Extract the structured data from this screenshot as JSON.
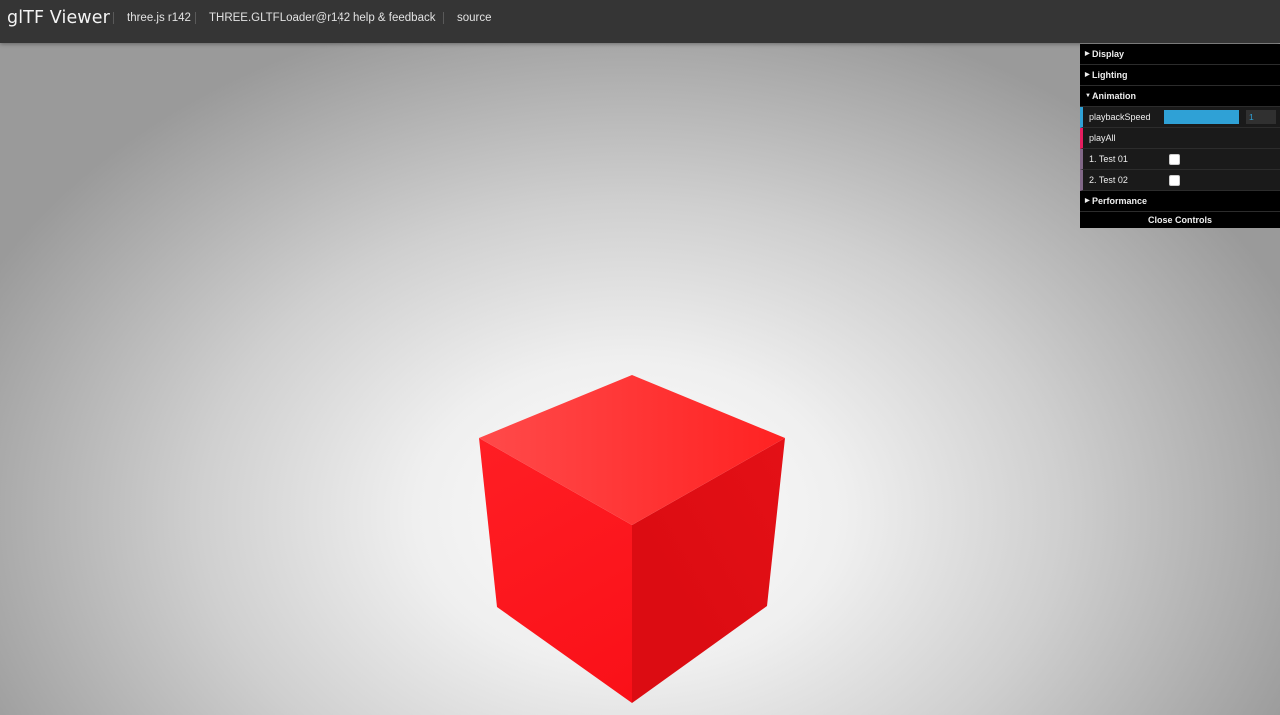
{
  "header": {
    "title": "glTF Viewer",
    "links": [
      "three.js r142",
      "THREE.GLTFLoader@r142",
      "help & feedback",
      "source"
    ]
  },
  "gui": {
    "folders": {
      "display": "Display",
      "lighting": "Lighting",
      "animation": "Animation",
      "performance": "Performance"
    },
    "animation": {
      "playback_speed_label": "playbackSpeed",
      "playback_speed_value": "1",
      "playback_speed_fraction": 1,
      "play_all_label": "playAll",
      "clips": [
        {
          "label": "1. Test 01",
          "checked": false
        },
        {
          "label": "2. Test 02",
          "checked": false
        }
      ]
    },
    "close_label": "Close Controls"
  },
  "colors": {
    "header_bg": "#353535",
    "accent_number": "#2fa1d6",
    "accent_function": "#e61d5f",
    "accent_boolean": "#806787",
    "cube_red": "#ff1a1a"
  }
}
